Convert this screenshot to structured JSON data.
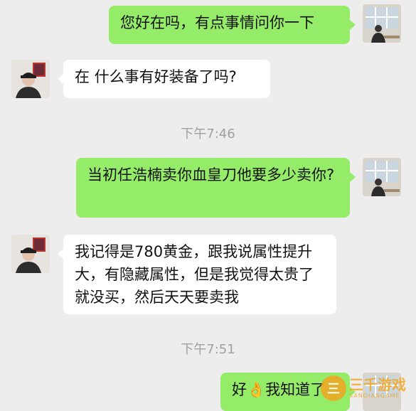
{
  "messages": [
    {
      "side": "me",
      "text": "您好在吗，有点事情问你一下"
    },
    {
      "side": "other",
      "text": "在 什么事有好装备了吗?"
    },
    {
      "side": "time",
      "text": "下午7:46"
    },
    {
      "side": "me",
      "text": "当初任浩楠卖你血皇刀他要多少卖你?"
    },
    {
      "side": "other",
      "text": "我记得是780黄金，跟我说属性提升大，有隐藏属性，但是我觉得太贵了就没买，然后天天要卖我"
    },
    {
      "side": "time",
      "text": "下午7:51"
    },
    {
      "side": "me",
      "text": "好👌我知道了"
    }
  ],
  "watermark": {
    "main": "三千游戏",
    "sub": "SANQIANGAME",
    "icon": "三"
  },
  "colors": {
    "background": "#ededed",
    "me_bubble": "#95ec69",
    "other_bubble": "#ffffff",
    "time": "#a0a0a0"
  }
}
